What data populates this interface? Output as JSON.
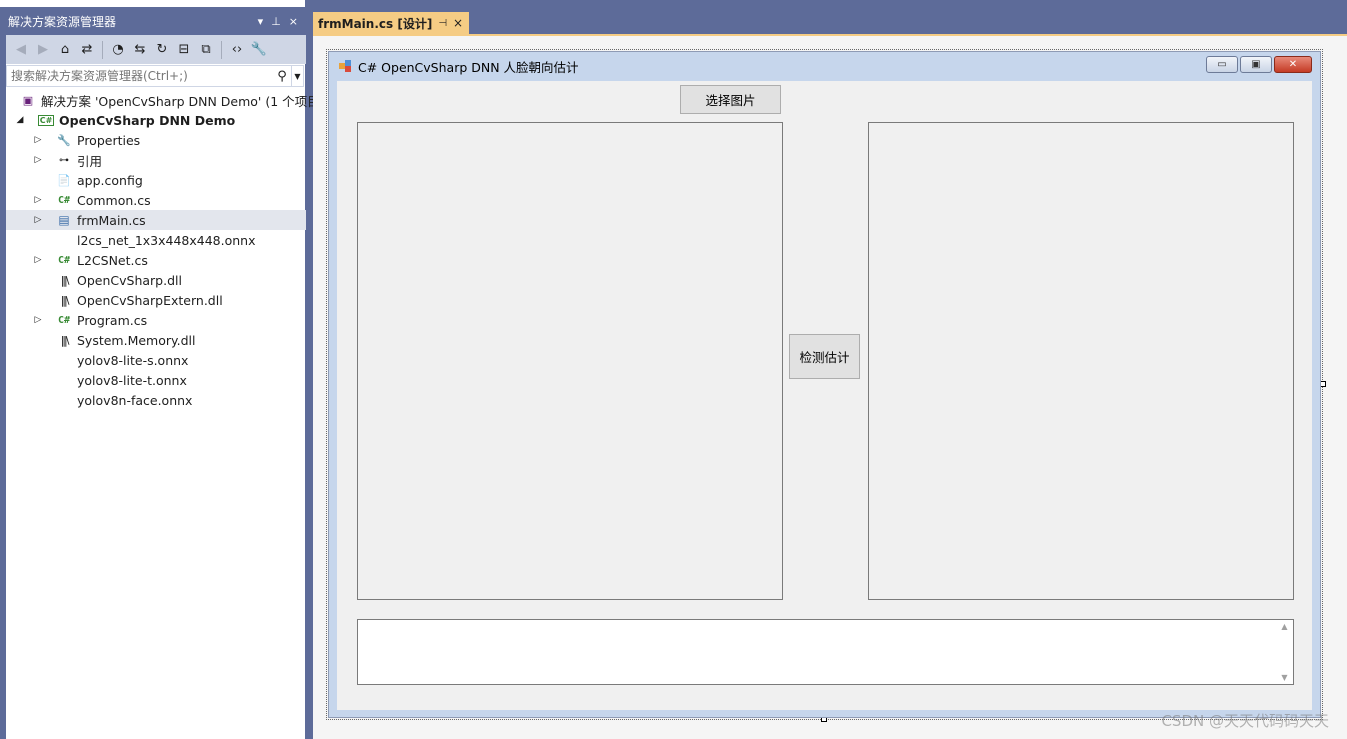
{
  "solution_explorer": {
    "title": "解决方案资源管理器",
    "title_controls": [
      "▾",
      "⊥",
      "×"
    ],
    "search_placeholder": "搜索解决方案资源管理器(Ctrl+;)",
    "tree": [
      {
        "label": "解决方案 'OpenCvSharp DNN Demo' (1 个项目",
        "icon": "solution-icon",
        "depth": 0,
        "expander": ""
      },
      {
        "label": "OpenCvSharp DNN Demo",
        "icon": "csharp-project-icon",
        "depth": 0,
        "expander": "◢",
        "bold": true
      },
      {
        "label": "Properties",
        "icon": "wrench-icon",
        "depth": 1,
        "expander": "▷"
      },
      {
        "label": "引用",
        "icon": "references-icon",
        "depth": 1,
        "expander": "▷"
      },
      {
        "label": "app.config",
        "icon": "config-icon",
        "depth": 1,
        "expander": ""
      },
      {
        "label": "Common.cs",
        "icon": "csharp-file-icon",
        "depth": 1,
        "expander": "▷"
      },
      {
        "label": "frmMain.cs",
        "icon": "form-icon",
        "depth": 1,
        "expander": "▷",
        "selected": true
      },
      {
        "label": "l2cs_net_1x3x448x448.onnx",
        "icon": "",
        "depth": 1,
        "expander": ""
      },
      {
        "label": "L2CSNet.cs",
        "icon": "csharp-file-icon",
        "depth": 1,
        "expander": "▷"
      },
      {
        "label": "OpenCvSharp.dll",
        "icon": "library-icon",
        "depth": 1,
        "expander": ""
      },
      {
        "label": "OpenCvSharpExtern.dll",
        "icon": "library-icon",
        "depth": 1,
        "expander": ""
      },
      {
        "label": "Program.cs",
        "icon": "csharp-file-icon",
        "depth": 1,
        "expander": "▷"
      },
      {
        "label": "System.Memory.dll",
        "icon": "library-icon",
        "depth": 1,
        "expander": ""
      },
      {
        "label": "yolov8-lite-s.onnx",
        "icon": "",
        "depth": 1,
        "expander": ""
      },
      {
        "label": "yolov8-lite-t.onnx",
        "icon": "",
        "depth": 1,
        "expander": ""
      },
      {
        "label": "yolov8n-face.onnx",
        "icon": "",
        "depth": 1,
        "expander": ""
      }
    ]
  },
  "document_tab": {
    "title": "frmMain.cs [设计]",
    "pin": "⊣",
    "close": "×"
  },
  "form": {
    "title": "C# OpenCvSharp DNN 人脸朝向估计",
    "select_image_button": "选择图片",
    "detect_button": "检测估计",
    "win_min": "▭",
    "win_max": "▣",
    "win_close": "✕"
  },
  "watermark": "CSDN @天天代码码天天"
}
